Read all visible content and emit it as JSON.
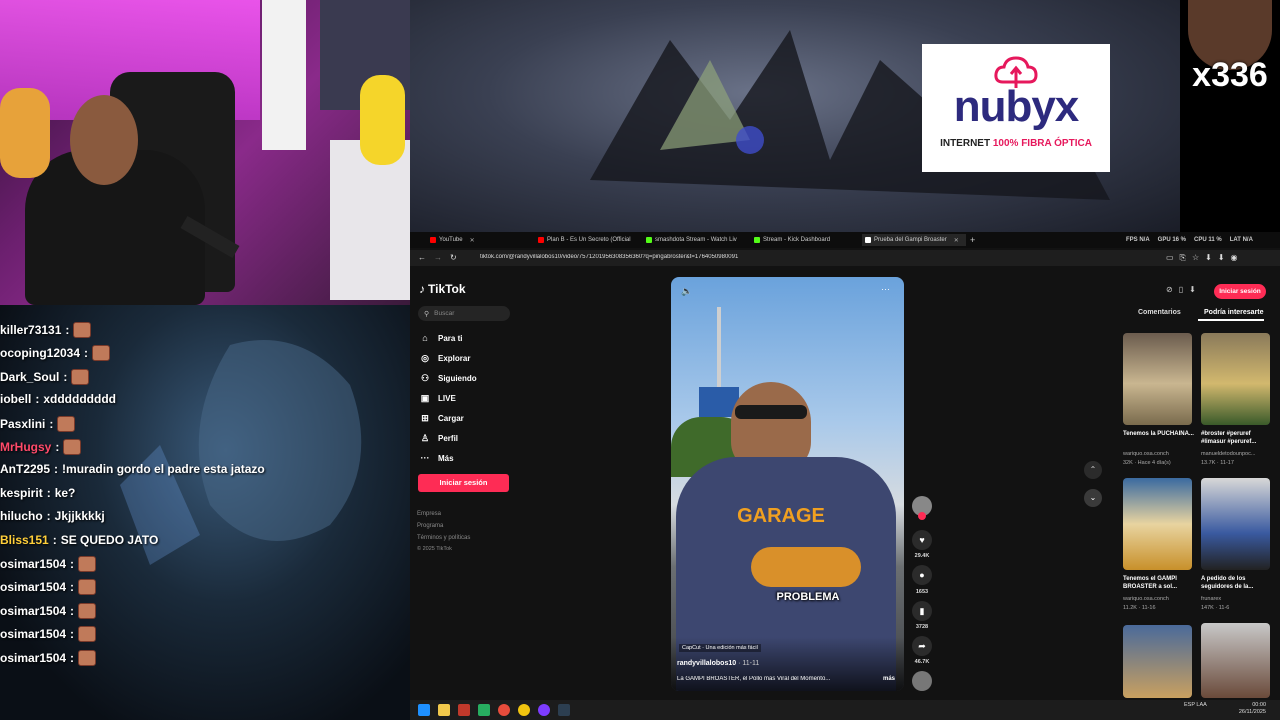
{
  "overlay": {
    "sponsor_logo": "nubyx",
    "sponsor_tag_prefix": "INTERNET ",
    "sponsor_tag_highlight": "100% FIBRA ÓPTICA",
    "counter": "x336"
  },
  "chat": [
    {
      "user": "killer73131",
      "msg": "",
      "color": "#ffffff",
      "emote": true
    },
    {
      "user": "ocoping12034",
      "msg": "",
      "color": "#ffffff",
      "emote": true
    },
    {
      "user": "Dark_Soul",
      "msg": "",
      "color": "#ffffff",
      "emote": true
    },
    {
      "user": "iobell",
      "msg": "xddddddddd",
      "color": "#ffffff",
      "emote": false
    },
    {
      "user": "Pasxlini",
      "msg": "",
      "color": "#ffffff",
      "emote": true
    },
    {
      "user": "MrHugsy",
      "msg": "",
      "color": "#ff4a6a",
      "emote": true
    },
    {
      "user": "AnT2295",
      "msg": "!muradin gordo el padre esta jatazo",
      "color": "#ffffff",
      "emote": false
    },
    {
      "user": "kespirit",
      "msg": "ke?",
      "color": "#ffffff",
      "emote": false
    },
    {
      "user": "hilucho",
      "msg": "Jkjjkkkkj",
      "color": "#ffffff",
      "emote": false
    },
    {
      "user": "Bliss151",
      "msg": "SE QUEDO JATO",
      "color": "#ffcf3a",
      "emote": false
    },
    {
      "user": "osimar1504",
      "msg": "",
      "color": "#ffffff",
      "emote": true
    },
    {
      "user": "osimar1504",
      "msg": "",
      "color": "#ffffff",
      "emote": true
    },
    {
      "user": "osimar1504",
      "msg": "",
      "color": "#ffffff",
      "emote": true
    },
    {
      "user": "osimar1504",
      "msg": "",
      "color": "#ffffff",
      "emote": true
    },
    {
      "user": "osimar1504",
      "msg": "",
      "color": "#ffffff",
      "emote": true
    }
  ],
  "browser": {
    "tabs": [
      {
        "label": "YouTube",
        "color": "#ff0000"
      },
      {
        "label": "Plan B - Es Un Secreto (Official",
        "color": "#ff0000"
      },
      {
        "label": "smashdota Stream - Watch Liv",
        "color": "#53fc18"
      },
      {
        "label": "Stream - Kick Dashboard",
        "color": "#53fc18"
      },
      {
        "label": "Prueba del Gampi Broaster",
        "color": "#ffffff"
      }
    ],
    "url": "tiktok.com/@randyvillalobos10/video/7571201956308356360?q=pingabroster&t=1764050980091",
    "perf": {
      "fps": "FPS N/A",
      "gpu": "GPU 16 %",
      "cpu": "CPU 11 %",
      "lat": "LAT N/A"
    }
  },
  "tiktok": {
    "logo": "TikTok",
    "search_placeholder": "Buscar",
    "nav": [
      "Para ti",
      "Explorar",
      "Siguiendo",
      "LIVE",
      "Cargar",
      "Perfil",
      "Más"
    ],
    "login": "Iniciar sesión",
    "footer": [
      "Empresa",
      "Programa",
      "Términos y políticas",
      "© 2025 TikTok"
    ],
    "video": {
      "caption_overlay": "PROBLEMA",
      "capcut": "CapCut · Una edición más fácil",
      "author": "randyvillalobos10",
      "date": "· 11-11",
      "description": "La GAMPI BROASTER, el Pollo mas Viral del Momento...",
      "more": "más"
    },
    "actions": {
      "likes": "29.4K",
      "comments": "1653",
      "saves": "3728",
      "shares": "46.7K"
    },
    "right": {
      "tab_comments": "Comentarios",
      "tab_suggest": "Podría interesarte",
      "login": "Iniciar sesión",
      "items": [
        {
          "title": "Tenemos la PUCHAINA...",
          "author": "wariquo.osa.conch",
          "meta": "32K · Hace 4 día(s)"
        },
        {
          "title": "#broster #peruref #limasur #peruref...",
          "author": "manueldetodounpoc...",
          "meta": "13.7K · 11-17"
        },
        {
          "title": "Tenemos el GAMPI BROASTER a sol...",
          "author": "wariquo.osa.conch",
          "meta": "11.2K · 11-16"
        },
        {
          "title": "A pedido de los seguidores de la...",
          "author": "frunarex",
          "meta": "147K · 11-6"
        }
      ]
    }
  },
  "taskbar": {
    "time": "00:00",
    "date": "26/11/2025",
    "lang": "ESP LAA"
  }
}
